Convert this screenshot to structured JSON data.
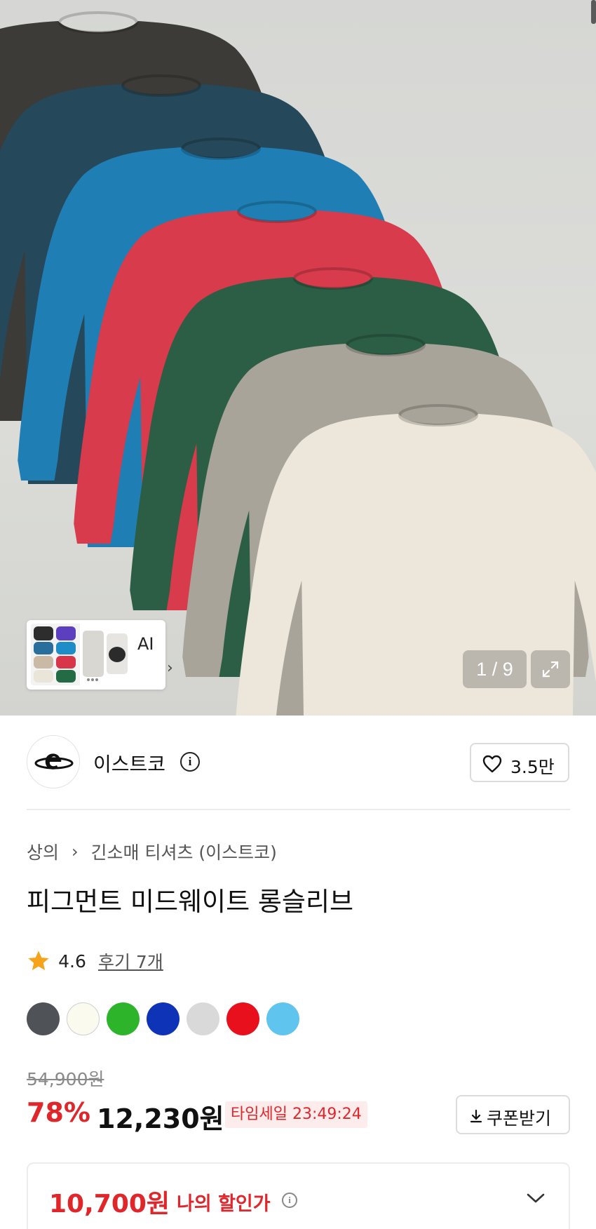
{
  "gallery": {
    "ai_label": "AI",
    "ai_chevron": "›",
    "page_indicator": "1 / 9",
    "icons": {
      "expand": "expand-arrows-icon",
      "chevron": "chevron-right-icon"
    }
  },
  "brand": {
    "name": "이스트코",
    "info_glyph": "i",
    "like_count": "3.5만",
    "icons": {
      "logo": "brand-logo-e",
      "heart": "heart-outline-icon",
      "info": "info-circle-icon"
    }
  },
  "product": {
    "breadcrumb": [
      "상의",
      "긴소매 티셔츠 (이스트코)"
    ],
    "breadcrumb_separator": "›",
    "title": "피그먼트 미드웨이트 롱슬리브",
    "rating": "4.6",
    "reviews": "후기 7개",
    "color_options": [
      "#4f5256",
      "#fbfaef",
      "#2eb42b",
      "#0f33b7",
      "#d9d9d9",
      "#e8101d",
      "#5fc5ee"
    ]
  },
  "price": {
    "original": "54,900원",
    "discount": "78%",
    "sale": "12,230원",
    "timesale": "타임세일 23:49:24",
    "coupon_label": "쿠폰받기",
    "accent_color": "#e0262b"
  },
  "my_price": {
    "amount": "10,700원",
    "label": "나의 할인가",
    "info_glyph": "i"
  }
}
